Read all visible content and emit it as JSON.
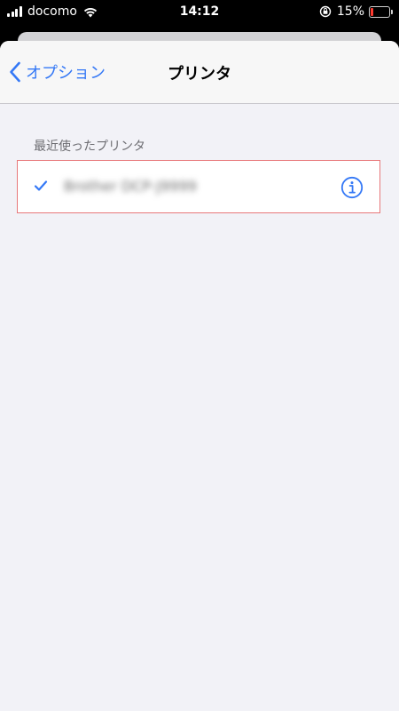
{
  "status_bar": {
    "carrier": "docomo",
    "time": "14:12",
    "battery_percent": "15%",
    "battery_level": 0.15,
    "icons": [
      "signal-icon",
      "wifi-icon",
      "rotation-lock-icon",
      "battery-icon"
    ]
  },
  "nav": {
    "back_label": "オプション",
    "title": "プリンタ"
  },
  "section": {
    "header": "最近使ったプリンタ"
  },
  "printer": {
    "name": "Brother DCP-J9999",
    "selected": true,
    "icons": [
      "checkmark-icon",
      "info-icon"
    ]
  },
  "colors": {
    "accent": "#3478f6",
    "background": "#f2f2f7",
    "highlight_border": "#e8787a",
    "battery_low": "#ff3b30"
  }
}
